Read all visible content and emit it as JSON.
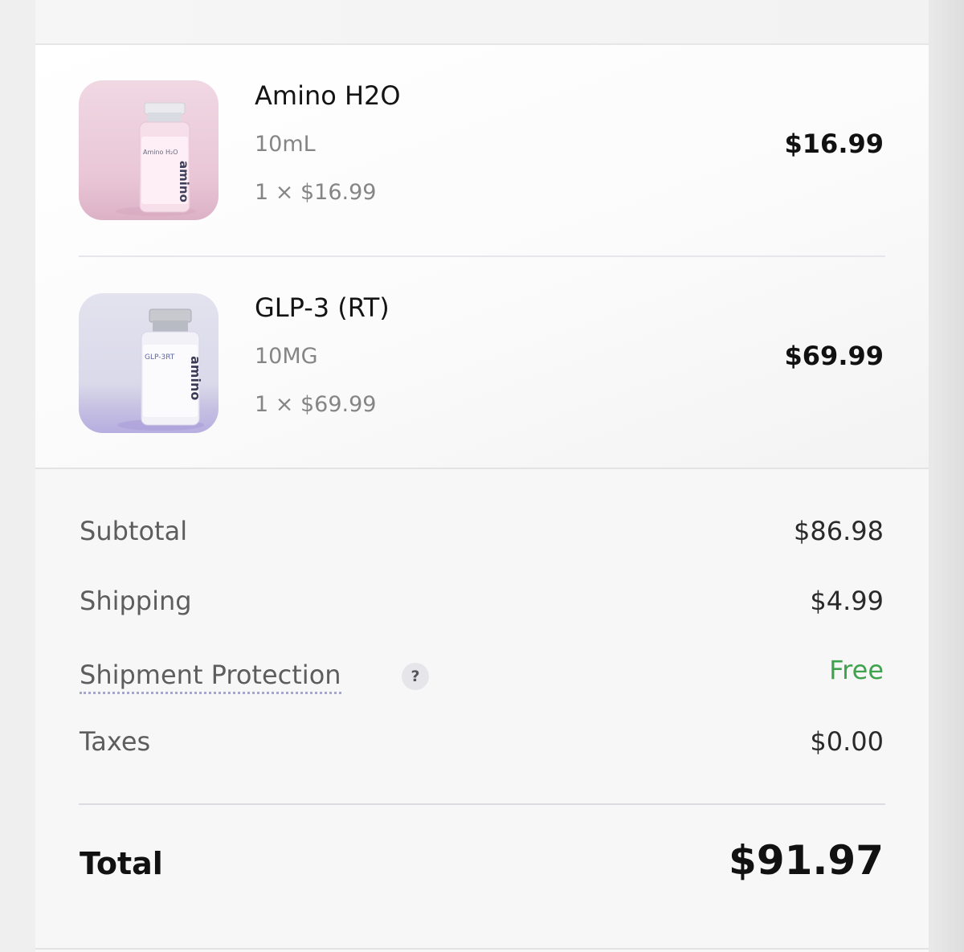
{
  "items": [
    {
      "name": "Amino H2O",
      "variant": "10mL",
      "quantity_line": "1 × $16.99",
      "price": "$16.99",
      "thumbnail": {
        "brand_text": "amino",
        "label_text": "Amino H₂O"
      }
    },
    {
      "name": "GLP-3 (RT)",
      "variant": "10MG",
      "quantity_line": "1 × $69.99",
      "price": "$69.99",
      "thumbnail": {
        "brand_text": "amino",
        "label_text": "GLP-3RT"
      }
    }
  ],
  "summary": {
    "subtotal_label": "Subtotal",
    "subtotal_value": "$86.98",
    "shipping_label": "Shipping",
    "shipping_value": "$4.99",
    "protection_label": "Shipment Protection",
    "protection_help": "?",
    "protection_value": "Free",
    "taxes_label": "Taxes",
    "taxes_value": "$0.00",
    "total_label": "Total",
    "total_value": "$91.97"
  },
  "colors": {
    "free_text": "#3fa34d",
    "muted_text": "#858585",
    "thumb_pink": "#e9c6d6",
    "thumb_lavender": "#c6c1e2"
  }
}
